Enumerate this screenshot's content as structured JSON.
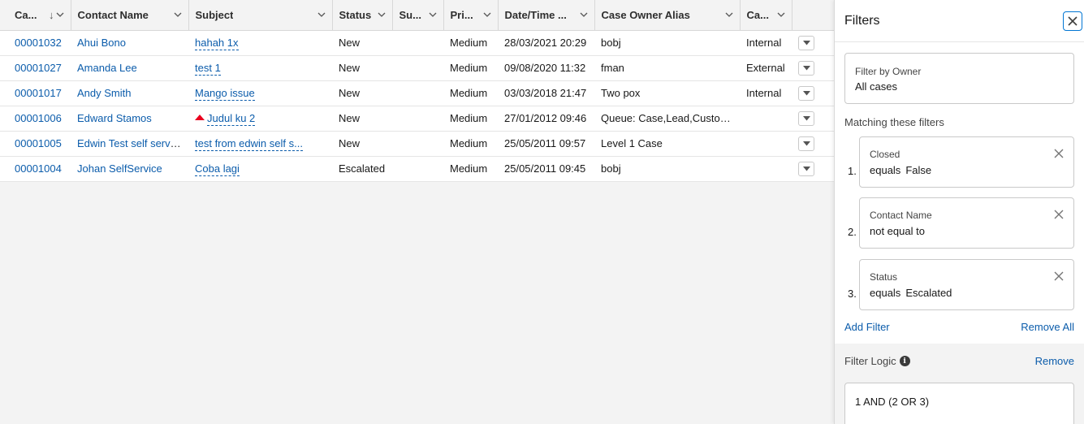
{
  "table": {
    "columns": [
      {
        "label": "Ca...",
        "sorted": true
      },
      {
        "label": "Contact Name"
      },
      {
        "label": "Subject"
      },
      {
        "label": "Status"
      },
      {
        "label": "Su..."
      },
      {
        "label": "Pri..."
      },
      {
        "label": "Date/Time ..."
      },
      {
        "label": "Case Owner Alias"
      },
      {
        "label": "Ca..."
      }
    ],
    "rows": [
      {
        "case": "00001032",
        "contact": "Ahui Bono",
        "subject": "hahah 1x",
        "flag": false,
        "status": "New",
        "sub": "",
        "priority": "Medium",
        "datetime": "28/03/2021 20:29",
        "owner": "bobj",
        "type": "Internal"
      },
      {
        "case": "00001027",
        "contact": "Amanda Lee",
        "subject": "test 1",
        "flag": false,
        "status": "New",
        "sub": "",
        "priority": "Medium",
        "datetime": "09/08/2020 11:32",
        "owner": "fman",
        "type": "External"
      },
      {
        "case": "00001017",
        "contact": "Andy Smith",
        "subject": "Mango issue",
        "flag": false,
        "status": "New",
        "sub": "",
        "priority": "Medium",
        "datetime": "03/03/2018 21:47",
        "owner": "Two pox",
        "type": "Internal"
      },
      {
        "case": "00001006",
        "contact": "Edward Stamos",
        "subject": "Judul ku 2",
        "flag": true,
        "status": "New",
        "sub": "",
        "priority": "Medium",
        "datetime": "27/01/2012 09:46",
        "owner": "Queue: Case,Lead,Customer",
        "type": ""
      },
      {
        "case": "00001005",
        "contact": "Edwin Test self service",
        "subject": "test from edwin self s...",
        "flag": false,
        "status": "New",
        "sub": "",
        "priority": "Medium",
        "datetime": "25/05/2011 09:57",
        "owner": "Level 1 Case",
        "type": ""
      },
      {
        "case": "00001004",
        "contact": "Johan SelfService",
        "subject": "Coba lagi",
        "flag": false,
        "status": "Escalated",
        "sub": "",
        "priority": "Medium",
        "datetime": "25/05/2011 09:45",
        "owner": "bobj",
        "type": ""
      }
    ]
  },
  "filters": {
    "title": "Filters",
    "owner_label": "Filter by Owner",
    "owner_value": "All cases",
    "matching_label": "Matching these filters",
    "items": [
      {
        "num": "1.",
        "field": "Closed",
        "op": "equals",
        "value": "False"
      },
      {
        "num": "2.",
        "field": "Contact Name",
        "op": "not equal to",
        "value": ""
      },
      {
        "num": "3.",
        "field": "Status",
        "op": "equals",
        "value": "Escalated"
      }
    ],
    "add_filter": "Add Filter",
    "remove_all": "Remove All",
    "logic_label": "Filter Logic",
    "logic_remove": "Remove",
    "logic_value": "1 AND (2 OR 3)"
  },
  "colors": {
    "link": "#0b5cab",
    "accent": "#0176d3",
    "flag": "#ea001e"
  }
}
